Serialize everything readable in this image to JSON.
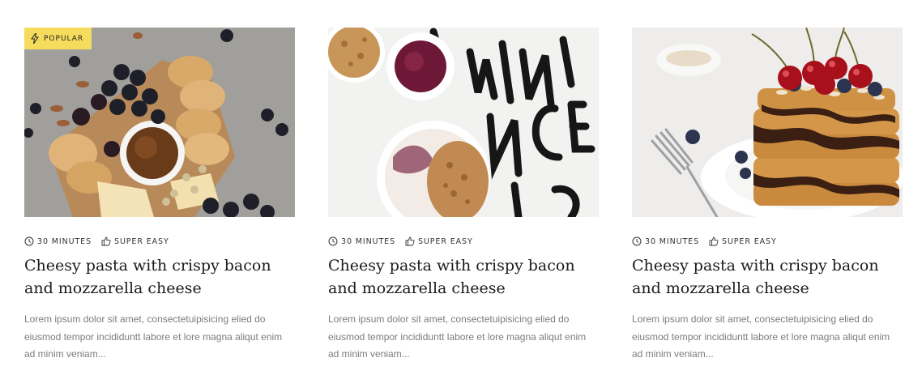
{
  "colors": {
    "badge": "#f6dc5d",
    "title": "#1b1b1b",
    "excerpt": "#7c7c7c",
    "meta": "#333333"
  },
  "cards": [
    {
      "badge": "POPULAR",
      "time": "30 MINUTES",
      "difficulty": "SUPER EASY",
      "title": "Cheesy pasta with crispy bacon and mozzarella cheese",
      "excerpt": "Lorem ipsum dolor sit amet, consectetuipisicing elied do eiusmod tempor incididuntt labore et lore magna aliqut enim ad minim veniam..."
    },
    {
      "time": "30 MINUTES",
      "difficulty": "SUPER EASY",
      "title": "Cheesy pasta with crispy bacon and mozzarella cheese",
      "excerpt": "Lorem ipsum dolor sit amet, consectetuipisicing elied do eiusmod tempor incididuntt labore et lore magna aliqut enim ad minim veniam..."
    },
    {
      "time": "30 MINUTES",
      "difficulty": "SUPER EASY",
      "title": "Cheesy pasta with crispy bacon and mozzarella cheese",
      "excerpt": "Lorem ipsum dolor sit amet, consectetuipisicing elied do eiusmod tempor incididuntt labore et lore magna aliqut enim ad minim veniam..."
    }
  ],
  "icons": {
    "time": "clock-icon",
    "difficulty": "thumbs-up-icon",
    "badge": "lightning-icon"
  }
}
